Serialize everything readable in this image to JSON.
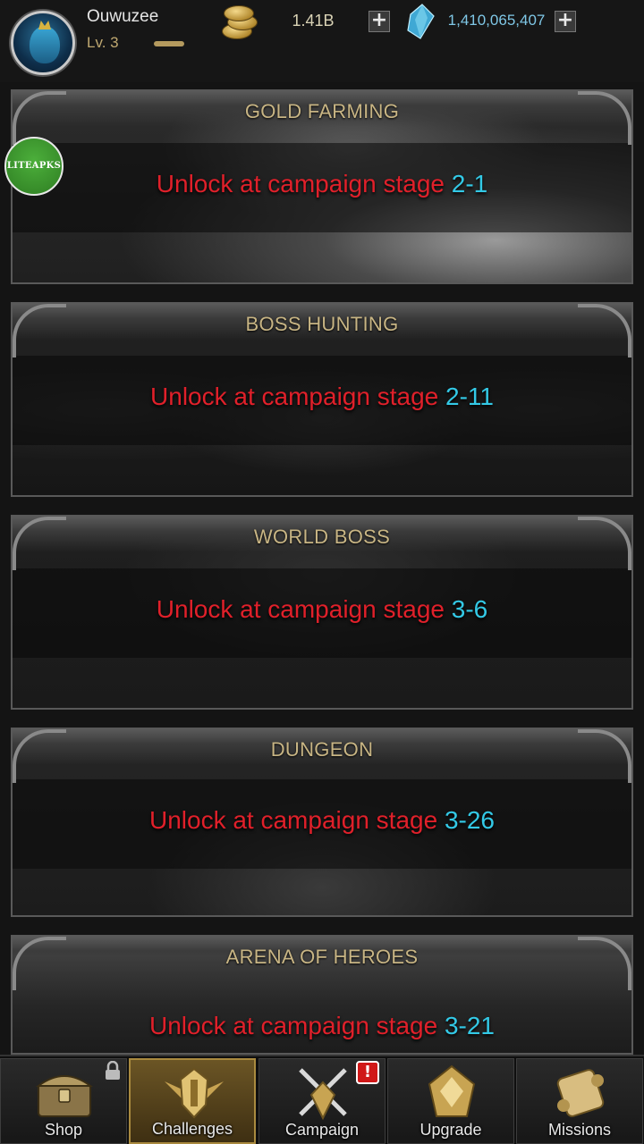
{
  "player": {
    "name": "Ouwuzee",
    "level": "Lv. 3",
    "gold": "1.41B",
    "gems": "1,410,065,407",
    "plus_label": "+"
  },
  "badge": {
    "text": "LITEAPKS"
  },
  "challenges": [
    {
      "title": "GOLD FARMING",
      "message": "Unlock at campaign stage ",
      "stage": "2-1"
    },
    {
      "title": "BOSS HUNTING",
      "message": "Unlock at campaign stage ",
      "stage": "2-11"
    },
    {
      "title": "WORLD BOSS",
      "message": "Unlock at campaign stage ",
      "stage": "3-6"
    },
    {
      "title": "DUNGEON",
      "message": "Unlock at campaign stage ",
      "stage": "3-26"
    },
    {
      "title": "ARENA OF HEROES",
      "message": "Unlock at campaign stage ",
      "stage": "3-21"
    }
  ],
  "nav": {
    "items": [
      {
        "label": "Shop",
        "icon": "treasure-chest-icon",
        "locked": true
      },
      {
        "label": "Challenges",
        "icon": "winged-helmet-icon",
        "active": true
      },
      {
        "label": "Campaign",
        "icon": "crossed-swords-icon",
        "alert": "!"
      },
      {
        "label": "Upgrade",
        "icon": "upgrade-emblem-icon"
      },
      {
        "label": "Missions",
        "icon": "scroll-icon"
      }
    ]
  },
  "colors": {
    "locked_text": "#e0202a",
    "stage_text": "#33c9e6",
    "title_gold": "#c8b584",
    "active_tab": "#a98a3f"
  }
}
